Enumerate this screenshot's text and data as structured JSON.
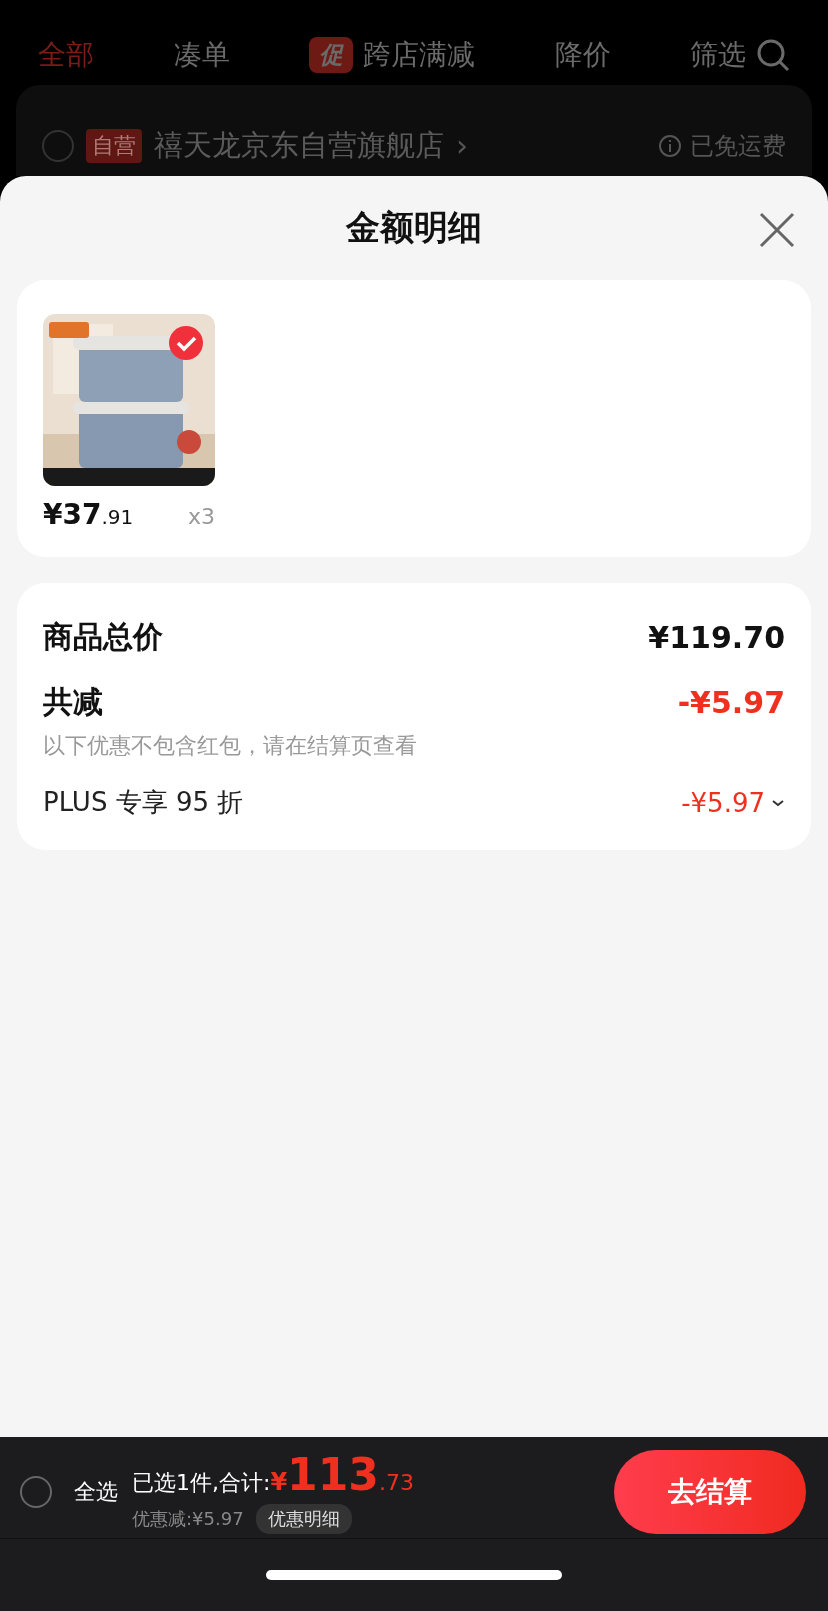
{
  "tabs": [
    {
      "label": "全部",
      "selected": true
    },
    {
      "label": "凑单",
      "selected": false
    },
    {
      "label": "跨店满减",
      "selected": false,
      "badge": "促"
    },
    {
      "label": "降价",
      "selected": false
    }
  ],
  "filter": {
    "label": "筛选"
  },
  "store": {
    "checked": false,
    "badge": "自营",
    "name": "禧天龙京东自营旗舰店",
    "chevron": "›",
    "shipping": "已免运费"
  },
  "sheet": {
    "title": "金额明细",
    "items": [
      {
        "kind": "picture",
        "selected": true,
        "price": "¥37",
        "price_decimal": ".91",
        "quantity": "x3"
      }
    ],
    "summary": {
      "total_label": "商品总价",
      "total_value": "¥119.70",
      "discount_label": "共减",
      "discount_value": "-¥5.97",
      "note": "以下优惠不包含红包，请在结算页查看",
      "rows": [
        {
          "label": "PLUS 专享 95 折",
          "value": "-¥5.97",
          "expanded": false
        }
      ]
    }
  },
  "bottom_bar": {
    "select_all": {
      "label": "全选",
      "checked": false
    },
    "selected_text": "已选1件,合计:",
    "currency": "¥",
    "total_integer": "113",
    "total_decimal": ".73",
    "saving": "优惠减:¥5.97",
    "detail_button": "优惠明细",
    "checkout": "去结算"
  }
}
